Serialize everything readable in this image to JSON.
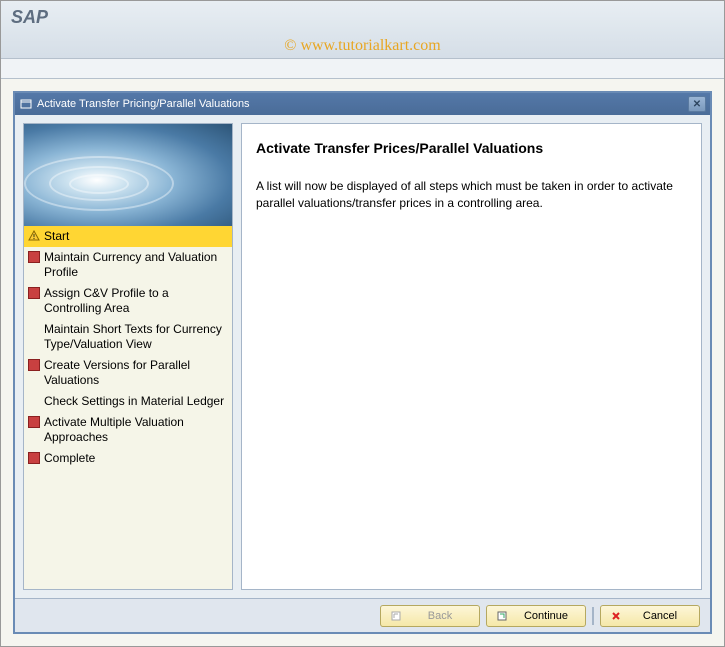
{
  "app": {
    "brand": "SAP",
    "watermark": "© www.tutorialkart.com"
  },
  "dialog": {
    "title": "Activate Transfer Pricing/Parallel Valuations",
    "close_label": "✕"
  },
  "steps": [
    {
      "label": "Start",
      "icon": "warning",
      "selected": true
    },
    {
      "label": "Maintain Currency and Valuation Profile",
      "icon": "box",
      "selected": false
    },
    {
      "label": "Assign C&V Profile to a Controlling Area",
      "icon": "box",
      "selected": false
    },
    {
      "label": "Maintain Short Texts for Currency Type/Valuation View",
      "icon": "none",
      "selected": false
    },
    {
      "label": "Create Versions for Parallel Valuations",
      "icon": "box",
      "selected": false
    },
    {
      "label": "Check Settings in Material Ledger",
      "icon": "none",
      "selected": false
    },
    {
      "label": "Activate Multiple Valuation Approaches",
      "icon": "box",
      "selected": false
    },
    {
      "label": "Complete",
      "icon": "box",
      "selected": false
    }
  ],
  "content": {
    "title": "Activate Transfer Prices/Parallel Valuations",
    "body": "A list will now be displayed of all steps which must be taken in order to activate parallel valuations/transfer prices in a controlling area."
  },
  "buttons": {
    "back": "Back",
    "continue": "Continue",
    "cancel": "Cancel"
  }
}
